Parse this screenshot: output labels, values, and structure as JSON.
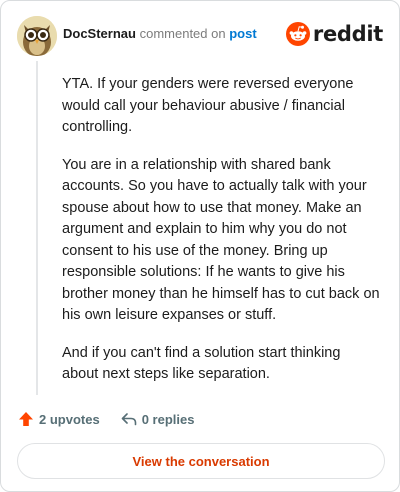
{
  "header": {
    "author": "DocSternau",
    "commented_text": "commented on",
    "post_link": "post",
    "brand_name": "reddit",
    "avatar_icon": "owl-avatar-icon",
    "brand_icon": "reddit-snoo-icon"
  },
  "comment": {
    "paragraphs": [
      "YTA. If your genders were reversed everyone would call your behaviour abusive / financial controlling.",
      "You are in a relationship with shared bank accounts. So you have to actually talk with your spouse about how to use that money. Make an argument and explain to him why you do not consent to his use of the money. Bring up responsible solutions: If he wants to give his brother money than he himself has to cut back on his own leisure expanses or stuff.",
      "And if you can't find a solution start thinking about next steps like separation."
    ]
  },
  "actions": {
    "upvotes": "2 upvotes",
    "replies": "0 replies",
    "upvote_icon": "upvote-arrow-icon",
    "reply_icon": "reply-arrow-icon"
  },
  "cta": {
    "label": "View the conversation"
  },
  "colors": {
    "accent": "#d93a00",
    "link": "#0079d3",
    "upvote": "#ff4500",
    "muted": "#576f76"
  }
}
